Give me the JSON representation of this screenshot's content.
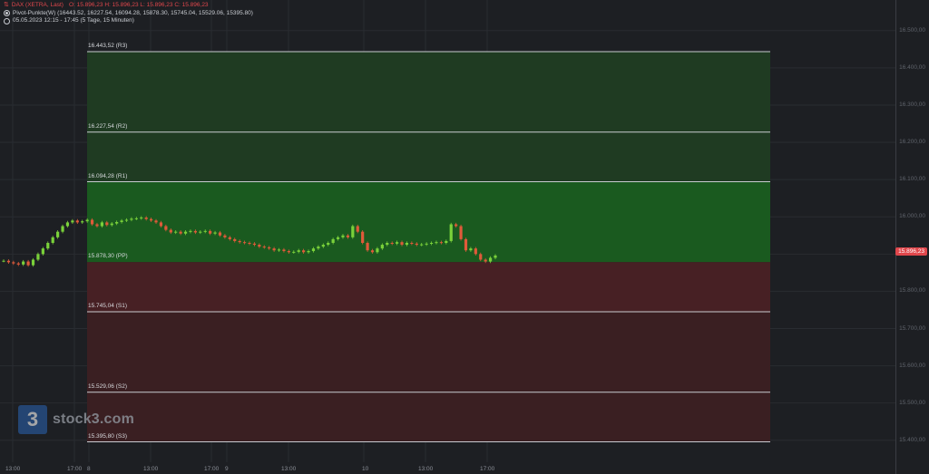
{
  "legend": {
    "instrument": "DAX (XETRA, Last)",
    "ohlc": "O: 15.896,23  H: 15.896,23  L: 15.896,23  C: 15.896,23",
    "indicator": "Pivot-Punkte(W)  (16443.52,  16227.54,  16094.28,  15878.30,  15745.04,  15529.06,  15395.80)",
    "period": "05.05.2023 12:15 - 17:45   (5 Tage, 15 Minuten)"
  },
  "current_price": "15.896,23",
  "colors": {
    "background": "#1d1f23",
    "resistance_zone": "#1f3b22",
    "resistance_zone_near": "#1a5a1f",
    "support_zone": "#3a1f22",
    "support_zone_near": "#472024",
    "up_candle": "#7ad13a",
    "down_candle": "#e05a3a",
    "price_tag": "#e0474c"
  },
  "pivot_levels": [
    {
      "label": "16.443,52 (R3)",
      "value": 16443.52
    },
    {
      "label": "16.227,54 (R2)",
      "value": 16227.54
    },
    {
      "label": "16.094,28 (R1)",
      "value": 16094.28
    },
    {
      "label": "15.878,30 (PP)",
      "value": 15878.3
    },
    {
      "label": "15.745,04 (S1)",
      "value": 15745.04
    },
    {
      "label": "15.529,06 (S2)",
      "value": 15529.06
    },
    {
      "label": "15.395,80 (S3)",
      "value": 15395.8
    }
  ],
  "y_axis": {
    "ticks": [
      "16.500,00",
      "16.400,00",
      "16.300,00",
      "16.200,00",
      "16.100,00",
      "16.000,00",
      "15.900,00",
      "15.800,00",
      "15.700,00",
      "15.600,00",
      "15.500,00",
      "15.400,00"
    ],
    "tick_values": [
      16500,
      16400,
      16300,
      16200,
      16100,
      16000,
      15900,
      15800,
      15700,
      15600,
      15500,
      15400
    ]
  },
  "x_axis": {
    "ticks": [
      "13:00",
      "17:00",
      "8",
      "13:00",
      "17:00",
      "9",
      "13:00",
      "10",
      "13:00",
      "17:00"
    ]
  },
  "branding": {
    "logo_mark": "3",
    "logo_text": "stock3.com"
  }
}
